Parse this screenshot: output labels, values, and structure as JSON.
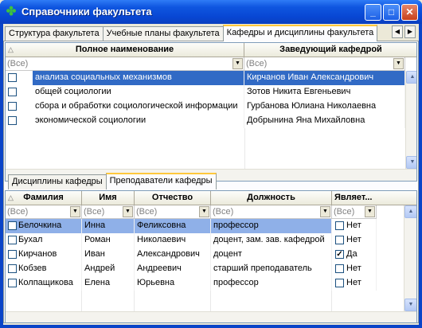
{
  "window": {
    "title": "Справочники факультета",
    "icon": "leaf-icon",
    "minimize_icon": "minimize-icon",
    "maximize_icon": "maximize-icon",
    "close_icon": "close-icon"
  },
  "top_tabs": {
    "items": [
      {
        "label": "Структура факультета"
      },
      {
        "label": "Учебные планы факультета"
      },
      {
        "label": "Кафедры и дисциплины факультета"
      }
    ],
    "active_index": 2,
    "scroll_left_glyph": "◀",
    "scroll_right_glyph": "▶"
  },
  "dept_grid": {
    "columns": [
      "Полное наименование",
      "Заведующий кафедрой"
    ],
    "filter_placeholder": "(Все)",
    "rows": [
      {
        "name": "анализа социальных механизмов",
        "head": "Кирчанов Иван Александрович",
        "checked": false,
        "selected": true
      },
      {
        "name": "общей социологии",
        "head": "Зотов Никита Евгеньевич",
        "checked": false,
        "selected": false
      },
      {
        "name": "сбора и обработки социологической информации",
        "head": "Гурбанова Юлиана Николаевна",
        "checked": false,
        "selected": false
      },
      {
        "name": "экономической социологии",
        "head": "Добрынина Яна Михайловна",
        "checked": false,
        "selected": false
      }
    ]
  },
  "sub_tabs": {
    "items": [
      {
        "label": "Дисциплины кафедры"
      },
      {
        "label": "Преподаватели кафедры"
      }
    ],
    "active_index": 1
  },
  "staff_grid": {
    "columns": [
      "Фамилия",
      "Имя",
      "Отчество",
      "Должность",
      "Являет..."
    ],
    "filter_placeholder": "(Все)",
    "rows": [
      {
        "last": "Белочкина",
        "first": "Инна",
        "middle": "Феликсовна",
        "position": "профессор",
        "is_head": false,
        "flag": "Нет",
        "selected": true
      },
      {
        "last": "Бухал",
        "first": "Роман",
        "middle": "Николаевич",
        "position": "доцент, зам. зав. кафедрой",
        "is_head": false,
        "flag": "Нет",
        "selected": false
      },
      {
        "last": "Кирчанов",
        "first": "Иван",
        "middle": "Александрович",
        "position": "доцент",
        "is_head": true,
        "flag": "Да",
        "selected": false
      },
      {
        "last": "Кобзев",
        "first": "Андрей",
        "middle": "Андреевич",
        "position": "старший преподаватель",
        "is_head": false,
        "flag": "Нет",
        "selected": false
      },
      {
        "last": "Колпащикова",
        "first": "Елена",
        "middle": "Юрьевна",
        "position": "профессор",
        "is_head": false,
        "flag": "Нет",
        "selected": false
      }
    ]
  },
  "colors": {
    "titlebar": "#0a44c8",
    "selection": "#316ac5",
    "selection_light": "#8fb0e8",
    "tab_highlight": "#ffc83c"
  }
}
